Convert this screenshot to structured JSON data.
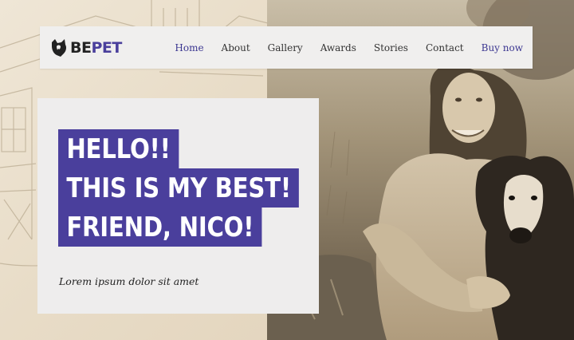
{
  "brand": {
    "logo_prefix": "BE",
    "logo_suffix": "PET",
    "accent_color": "#4a3f9c"
  },
  "nav": {
    "items": [
      {
        "label": "Home",
        "active": true
      },
      {
        "label": "About"
      },
      {
        "label": "Gallery"
      },
      {
        "label": "Awards"
      },
      {
        "label": "Stories"
      },
      {
        "label": "Contact"
      }
    ],
    "cta_label": "Buy now"
  },
  "hero": {
    "headline_lines": [
      "HELLO!!",
      "THIS IS MY BEST!",
      "FRIEND, NICO!"
    ],
    "subtitle": "Lorem ipsum dolor sit amet"
  },
  "icons": {
    "logo": "dog-head-icon"
  }
}
